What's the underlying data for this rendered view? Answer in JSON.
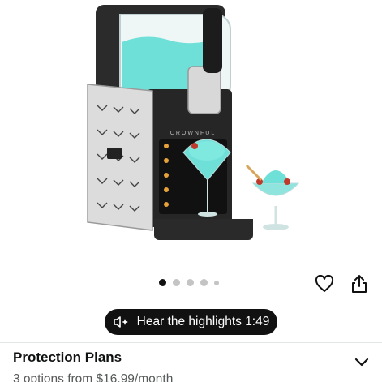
{
  "product": {
    "brand_on_device": "CROWNFUL",
    "colors": {
      "slush": "#6fe0d8",
      "body": "#2a2a2a",
      "steel": "#d9d9d9"
    }
  },
  "carousel": {
    "dots": [
      {
        "state": "active"
      },
      {
        "state": "inactive"
      },
      {
        "state": "inactive"
      },
      {
        "state": "inactive"
      },
      {
        "state": "inactive-small"
      }
    ],
    "favorite_icon": "heart-outline-icon",
    "share_icon": "share-icon"
  },
  "highlights": {
    "label": "Hear the highlights 1:49",
    "icon": "audio-sparkle-icon"
  },
  "protection_plans": {
    "title": "Protection Plans",
    "subtitle": "3 options from $16.99/month",
    "chevron_icon": "chevron-down-icon"
  }
}
